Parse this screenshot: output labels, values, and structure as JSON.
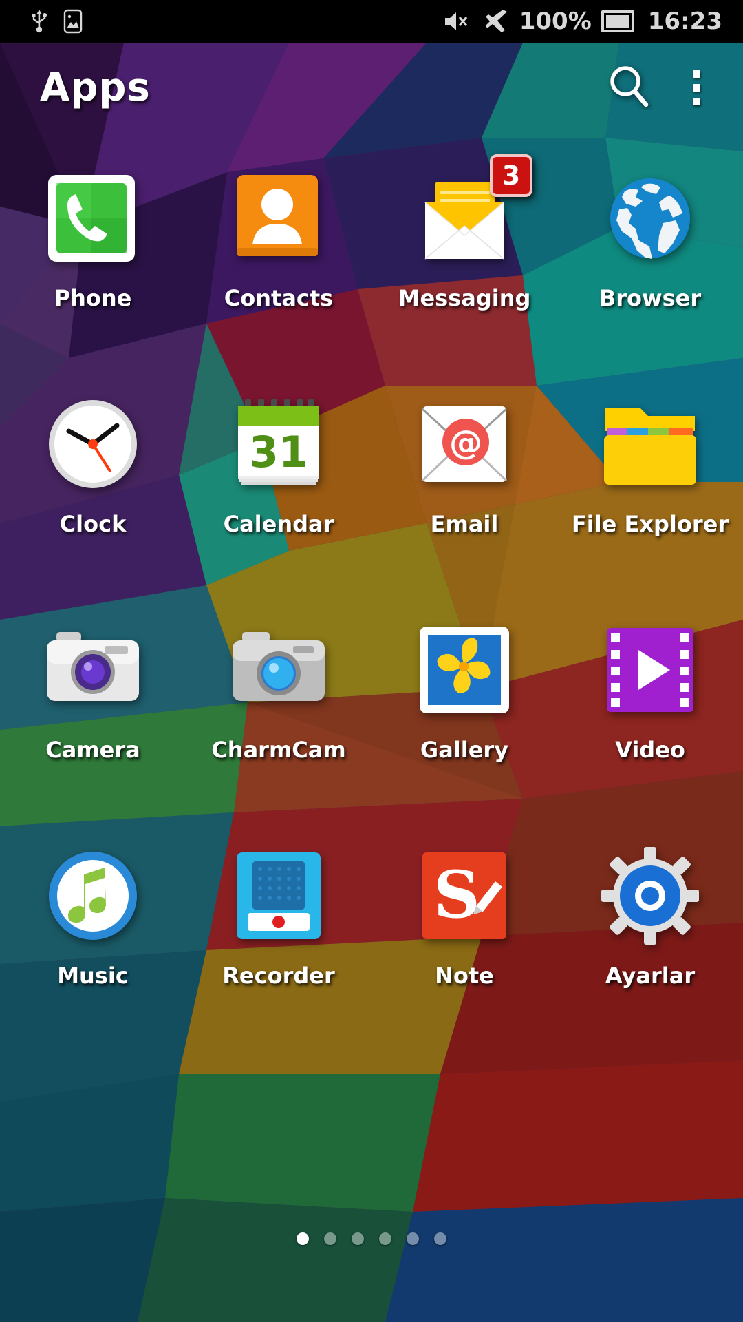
{
  "statusbar": {
    "left_icons": [
      "usb-icon",
      "screenshot-icon"
    ],
    "mute_icon": "volume-mute-icon",
    "airplane_icon": "airplane-mode-icon",
    "battery_percent": "100%",
    "battery_icon": "battery-full-icon",
    "time": "16:23"
  },
  "header": {
    "title": "Apps",
    "search_icon": "search-icon",
    "menu_icon": "overflow-menu-icon"
  },
  "apps": [
    {
      "label": "Phone",
      "icon": "phone-icon",
      "badge": null
    },
    {
      "label": "Contacts",
      "icon": "contacts-icon",
      "badge": null
    },
    {
      "label": "Messaging",
      "icon": "messaging-icon",
      "badge": "3"
    },
    {
      "label": "Browser",
      "icon": "browser-icon",
      "badge": null
    },
    {
      "label": "Clock",
      "icon": "clock-icon",
      "badge": null
    },
    {
      "label": "Calendar",
      "icon": "calendar-icon",
      "badge": null
    },
    {
      "label": "Email",
      "icon": "email-icon",
      "badge": null
    },
    {
      "label": "File Explorer",
      "icon": "file-explorer-icon",
      "badge": null
    },
    {
      "label": "Camera",
      "icon": "camera-icon",
      "badge": null
    },
    {
      "label": "CharmCam",
      "icon": "charmcam-icon",
      "badge": null
    },
    {
      "label": "Gallery",
      "icon": "gallery-icon",
      "badge": null
    },
    {
      "label": "Video",
      "icon": "video-icon",
      "badge": null
    },
    {
      "label": "Music",
      "icon": "music-icon",
      "badge": null
    },
    {
      "label": "Recorder",
      "icon": "recorder-icon",
      "badge": null
    },
    {
      "label": "Note",
      "icon": "note-icon",
      "badge": null
    },
    {
      "label": "Ayarlar",
      "icon": "settings-icon",
      "badge": null
    }
  ],
  "calendar_day": "31",
  "note_letter": "S",
  "pages": {
    "count": 6,
    "active_index": 0
  },
  "colors": {
    "phone_green": "#34b233",
    "contacts_orange": "#f58b0f",
    "messaging_yellow": "#ffc400",
    "badge_red": "#cc1111",
    "browser_blue": "#1586cc",
    "calendar_green": "#7cb518",
    "email_red": "#f0544f",
    "folder_yellow": "#ffd000",
    "video_purple": "#a020d0",
    "note_red": "#e8401f",
    "recorder_blue": "#29b6e8",
    "settings_blue": "#1a6fd4",
    "music_green": "#8cc63f"
  }
}
